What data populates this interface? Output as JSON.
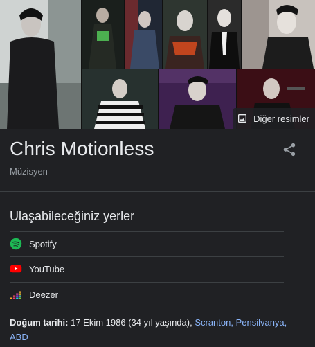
{
  "knowledge_panel": {
    "title": "Chris Motionless",
    "subtitle": "Müzisyen",
    "more_images_label": "Diğer resimler",
    "share_icon": "share-icon",
    "more_images_icon": "image-icon"
  },
  "where_to_listen": {
    "heading": "Ulaşabileceğiniz yerler",
    "items": [
      {
        "label": "Spotify",
        "icon": "spotify-icon",
        "color": "#1db954"
      },
      {
        "label": "YouTube",
        "icon": "youtube-icon",
        "color": "#ff0000"
      },
      {
        "label": "Deezer",
        "icon": "deezer-icon",
        "color": "#feaa2d"
      }
    ]
  },
  "facts": {
    "birth_label": "Doğum tarihi:",
    "birth_value": " 17 Ekim 1986 (34 yıl yaşında), ",
    "birth_place": "Scranton, Pensilvanya, ABD"
  },
  "colors": {
    "background": "#202124",
    "text": "#e8eaed",
    "muted": "#9aa0a6",
    "link": "#8ab4f8",
    "divider": "#3c4043"
  }
}
